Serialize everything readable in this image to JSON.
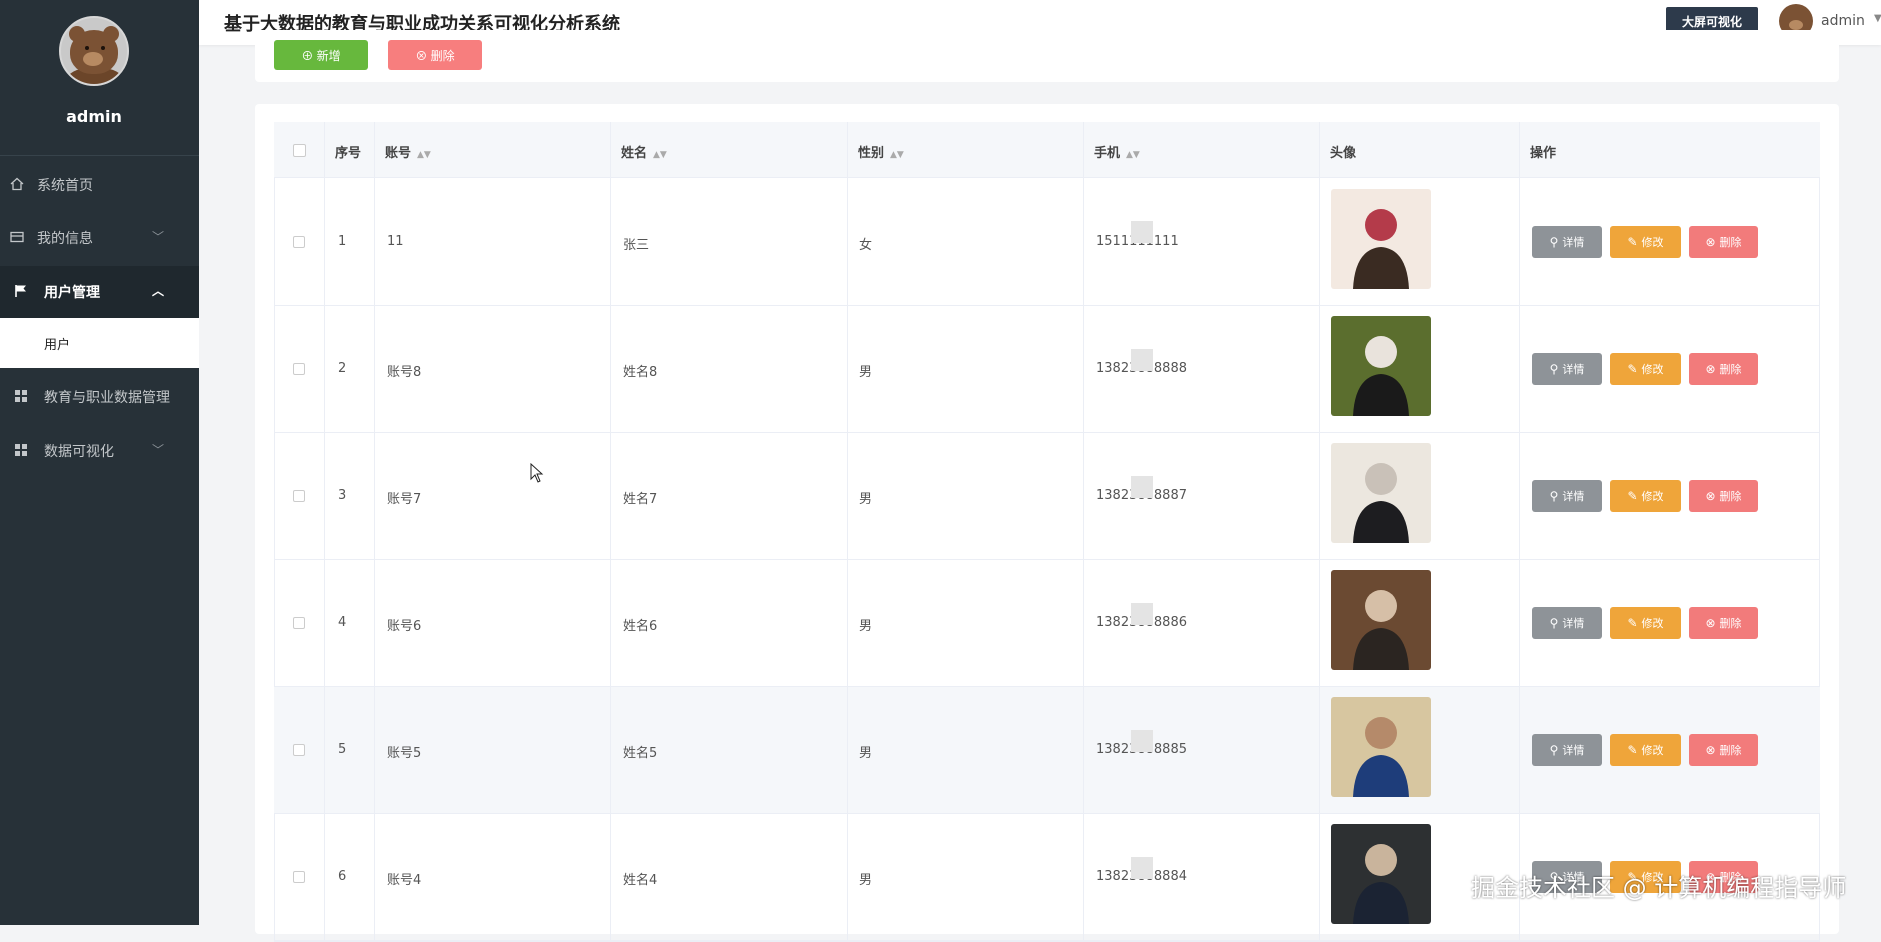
{
  "sidebar": {
    "username": "admin",
    "items": [
      {
        "label": "系统首页",
        "icon": "home-icon"
      },
      {
        "label": "我的信息",
        "icon": "card-icon"
      },
      {
        "label": "用户管理",
        "icon": "flag-icon"
      },
      {
        "label": "教育与职业数据管理",
        "icon": "grid-icon"
      },
      {
        "label": "数据可视化",
        "icon": "grid-icon"
      }
    ],
    "submenu_label": "用户"
  },
  "header": {
    "title": "基于大数据的教育与职业成功关系可视化分析系统",
    "bigscreen_label": "大屏可视化",
    "user": "admin"
  },
  "toolbar": {
    "add_label": "新增",
    "delete_label": "删除"
  },
  "table": {
    "columns": [
      "序号",
      "账号",
      "姓名",
      "性别",
      "手机",
      "头像",
      "操作"
    ],
    "rows": [
      {
        "index": "1",
        "account": "11",
        "name": "张三",
        "gender": "女",
        "phone": "1511111111"
      },
      {
        "index": "2",
        "account": "账号8",
        "name": "姓名8",
        "gender": "男",
        "phone": "13823888888"
      },
      {
        "index": "3",
        "account": "账号7",
        "name": "姓名7",
        "gender": "男",
        "phone": "13823888887"
      },
      {
        "index": "4",
        "account": "账号6",
        "name": "姓名6",
        "gender": "男",
        "phone": "13823888886"
      },
      {
        "index": "5",
        "account": "账号5",
        "name": "姓名5",
        "gender": "男",
        "phone": "13823888885"
      },
      {
        "index": "6",
        "account": "账号4",
        "name": "姓名4",
        "gender": "男",
        "phone": "13823888884"
      }
    ],
    "actions": {
      "detail": "详情",
      "edit": "修改",
      "delete": "删除"
    }
  },
  "watermark": "掘金技术社区 @ 计算机编程指导师",
  "colors": {
    "sidebar": "#273138",
    "add": "#67b83d",
    "delete": "#f77e7e",
    "detail": "#8e9398",
    "edit": "#efa53a",
    "header_btn": "#2d3a4b"
  }
}
